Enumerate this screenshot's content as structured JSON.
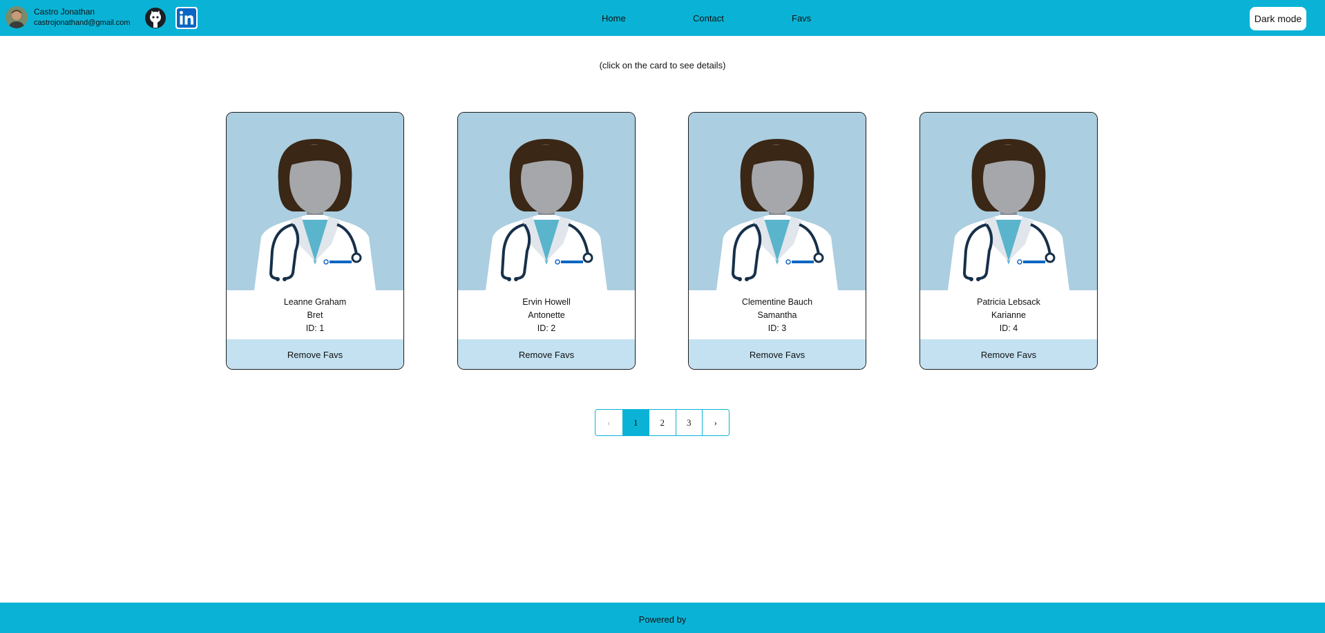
{
  "header": {
    "profile": {
      "name": "Castro Jonathan",
      "email": "castrojonathand@gmail.com"
    },
    "social": [
      "github-icon",
      "linkedin-icon"
    ],
    "nav": {
      "home": "Home",
      "contact": "Contact",
      "favs": "Favs"
    },
    "dark_mode_label": "Dark mode"
  },
  "main": {
    "hint": "(click on the card to see details)",
    "cards": [
      {
        "name": "Leanne Graham",
        "username": "Bret",
        "id": "ID: 1",
        "button": "Remove Favs"
      },
      {
        "name": "Ervin Howell",
        "username": "Antonette",
        "id": "ID: 2",
        "button": "Remove Favs"
      },
      {
        "name": "Clementine Bauch",
        "username": "Samantha",
        "id": "ID: 3",
        "button": "Remove Favs"
      },
      {
        "name": "Patricia Lebsack",
        "username": "Karianne",
        "id": "ID: 4",
        "button": "Remove Favs"
      }
    ],
    "pagination": {
      "prev": "‹",
      "pages": [
        "1",
        "2",
        "3"
      ],
      "active": "1",
      "next": "›"
    }
  },
  "footer": {
    "text": "Powered by"
  },
  "colors": {
    "accent": "#0ab3d6",
    "card_image_bg": "#abcee0",
    "button_bg": "#c3e1f1"
  }
}
